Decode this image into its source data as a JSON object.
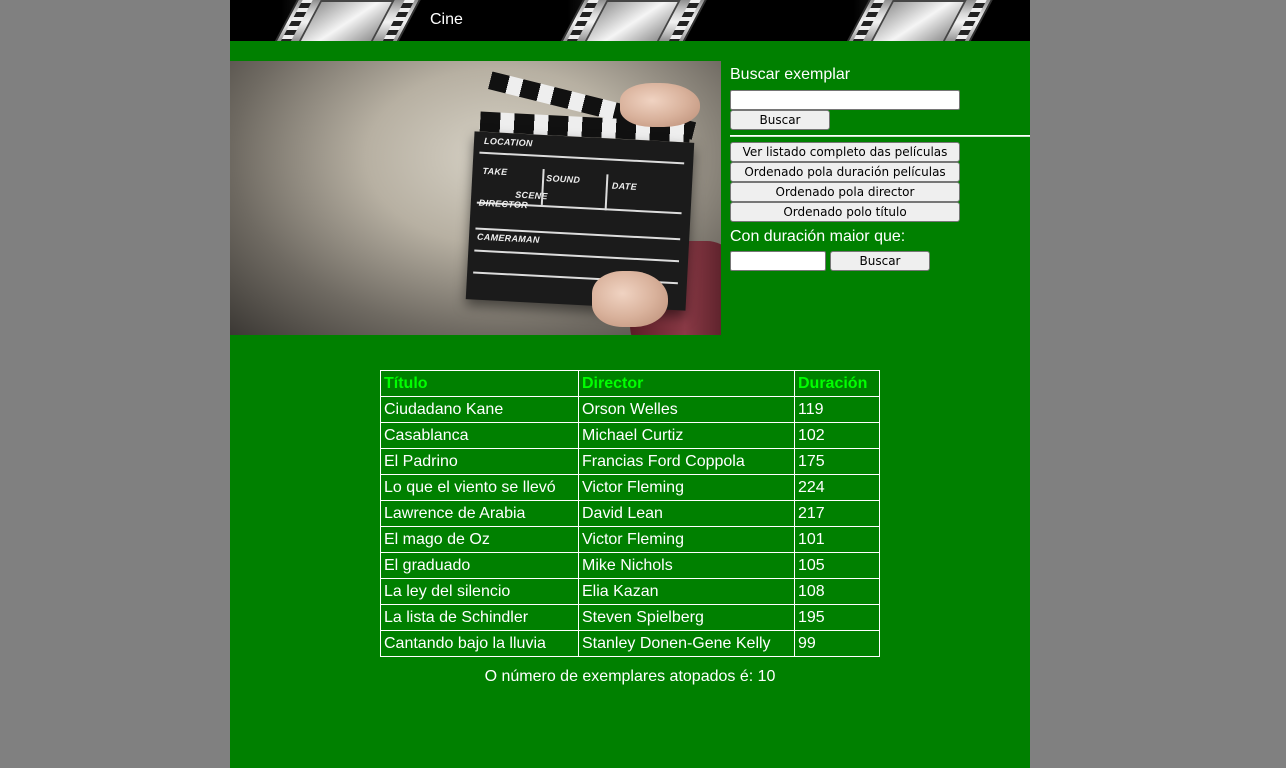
{
  "header": {
    "title": "Cine"
  },
  "search": {
    "label": "Buscar exemplar",
    "value": "",
    "button_label": "Buscar"
  },
  "actions": {
    "full_list": "Ver listado completo das películas",
    "sort_duration": "Ordenado pola duración películas",
    "sort_director": "Ordenado pola director",
    "sort_title": "Ordenado polo título"
  },
  "duration_filter": {
    "label": "Con duración maior que:",
    "value": "",
    "button_label": "Buscar"
  },
  "hero_image": {
    "clapper_text": {
      "location": "LOCATION",
      "take": "TAKE",
      "sound": "SOUND",
      "date": "DATE",
      "scene": "SCENE",
      "director": "DIRECTOR",
      "cameraman": "CAMERAMAN"
    }
  },
  "table": {
    "headers": [
      "Título",
      "Director",
      "Duración"
    ],
    "rows": [
      [
        "Ciudadano Kane",
        "Orson Welles",
        "119"
      ],
      [
        "Casablanca",
        "Michael Curtiz",
        "102"
      ],
      [
        "El Padrino",
        "Francias Ford Coppola",
        "175"
      ],
      [
        "Lo que el viento se llevó",
        "Victor Fleming",
        "224"
      ],
      [
        "Lawrence de Arabia",
        "David Lean",
        "217"
      ],
      [
        "El mago de Oz",
        "Victor Fleming",
        "101"
      ],
      [
        "El graduado",
        "Mike Nichols",
        "105"
      ],
      [
        "La ley del silencio",
        "Elia Kazan",
        "108"
      ],
      [
        "La lista de Schindler",
        "Steven Spielberg",
        "195"
      ],
      [
        "Cantando bajo la lluvia",
        "Stanley Donen-Gene Kelly",
        "99"
      ]
    ]
  },
  "result_count": {
    "text": "O número de exemplares atopados é: 10"
  },
  "colors": {
    "page_background": "#808080",
    "content_background": "#008000",
    "table_header_text": "#00ff00",
    "text": "#ffffff"
  }
}
